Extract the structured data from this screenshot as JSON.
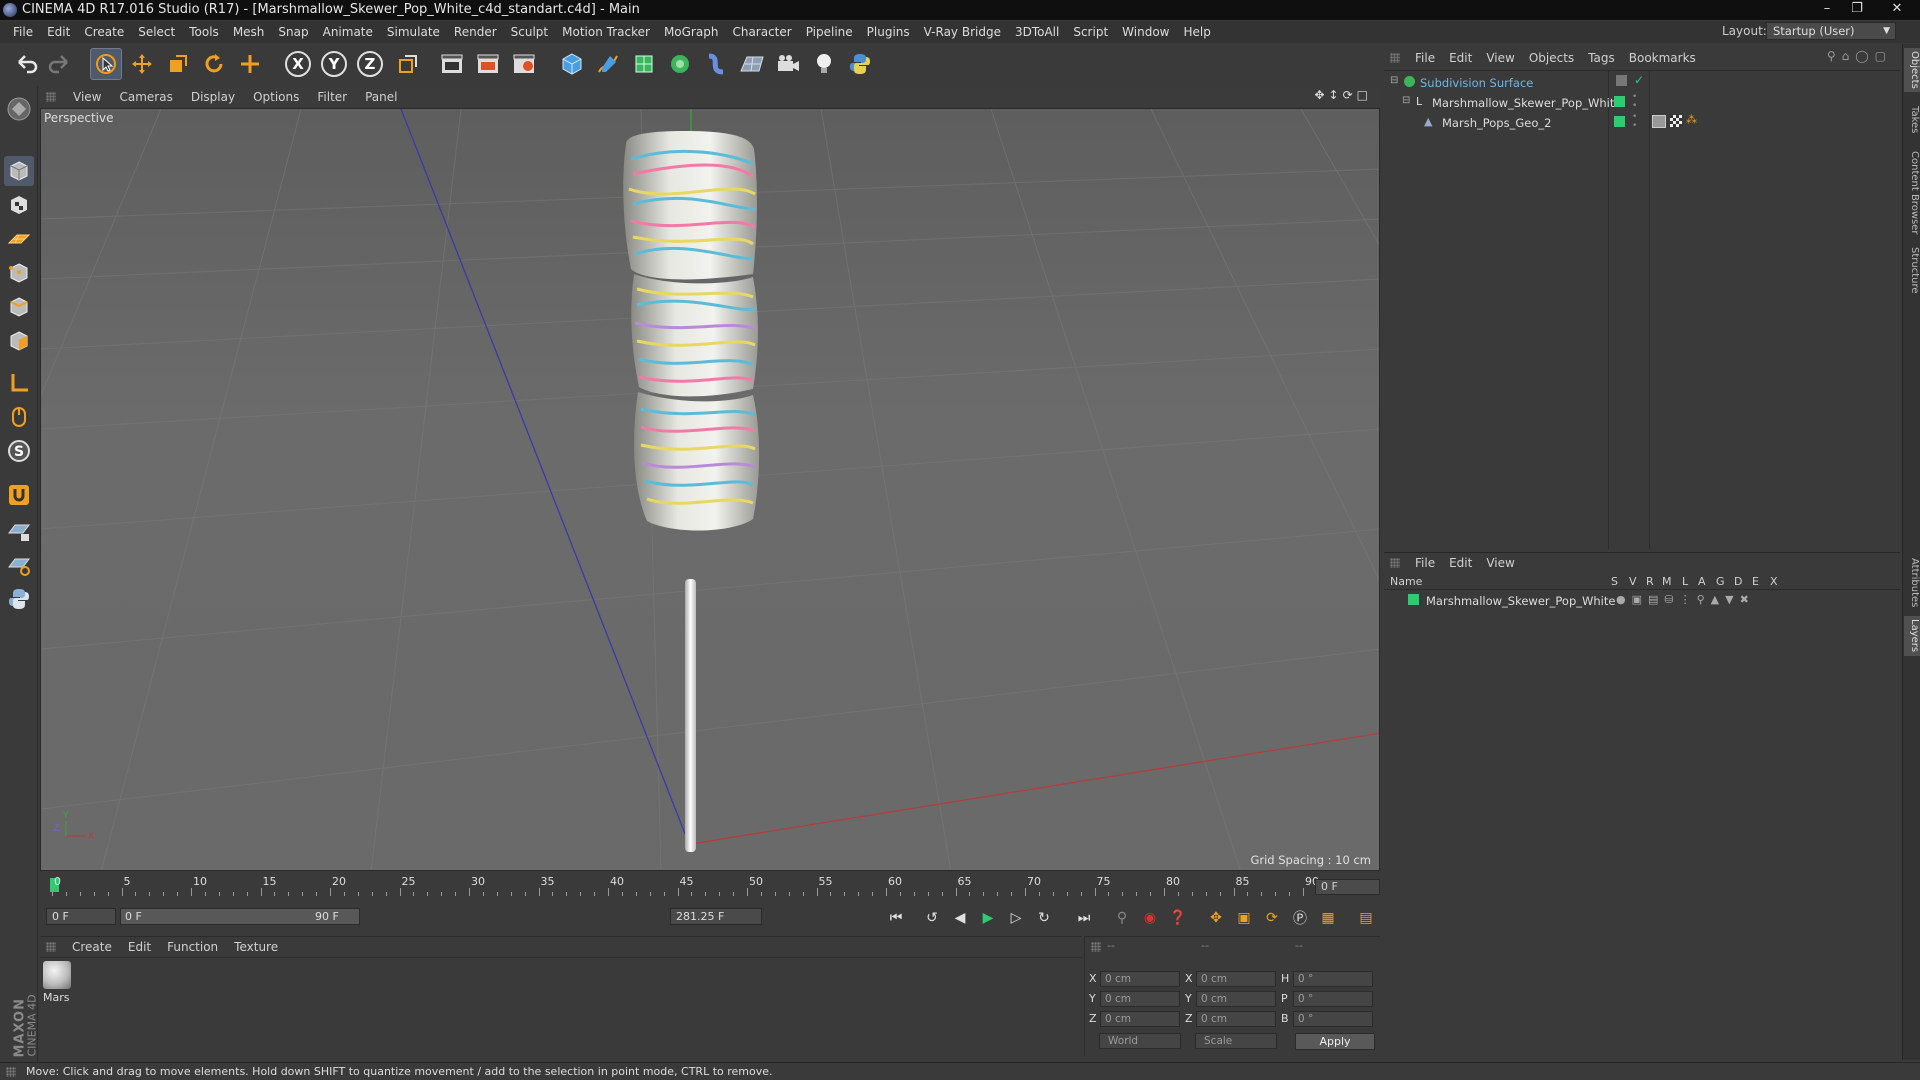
{
  "window": {
    "title": "CINEMA 4D R17.016 Studio (R17) - [Marshmallow_Skewer_Pop_White_c4d_standart.c4d] - Main"
  },
  "menubar": {
    "items": [
      "File",
      "Edit",
      "Create",
      "Select",
      "Tools",
      "Mesh",
      "Snap",
      "Animate",
      "Simulate",
      "Render",
      "Sculpt",
      "Motion Tracker",
      "MoGraph",
      "Character",
      "Pipeline",
      "Plugins",
      "V-Ray Bridge",
      "3DToAll",
      "Script",
      "Window",
      "Help"
    ],
    "layout_label": "Layout:",
    "layout_value": "Startup (User)"
  },
  "toolbar": {
    "axis_x": "X",
    "axis_y": "Y",
    "axis_z": "Z"
  },
  "viewport": {
    "menu": [
      "View",
      "Cameras",
      "Display",
      "Options",
      "Filter",
      "Panel"
    ],
    "label": "Perspective",
    "grid_spacing": "Grid Spacing : 10 cm"
  },
  "timeline": {
    "ticks": [
      "0",
      "5",
      "10",
      "15",
      "20",
      "25",
      "30",
      "35",
      "40",
      "45",
      "50",
      "55",
      "60",
      "65",
      "70",
      "75",
      "80",
      "85",
      "90"
    ],
    "current_frame_right": "0 F"
  },
  "transport": {
    "start_frame": "0 F",
    "range_start": "0 F",
    "range_end": "90 F",
    "fps_field": "281.25 F"
  },
  "material_manager": {
    "menu": [
      "Create",
      "Edit",
      "Function",
      "Texture"
    ],
    "materials": [
      {
        "name": "Mars"
      }
    ]
  },
  "coordinates": {
    "header": [
      "--",
      "--",
      "--"
    ],
    "rows": [
      {
        "a": "X",
        "a_val": "0 cm",
        "b": "X",
        "b_val": "0 cm",
        "c": "H",
        "c_val": "0 °"
      },
      {
        "a": "Y",
        "a_val": "0 cm",
        "b": "Y",
        "b_val": "0 cm",
        "c": "P",
        "c_val": "0 °"
      },
      {
        "a": "Z",
        "a_val": "0 cm",
        "b": "Z",
        "b_val": "0 cm",
        "c": "B",
        "c_val": "0 °"
      }
    ],
    "space": "World",
    "mode": "Scale",
    "apply": "Apply"
  },
  "object_manager": {
    "menu": [
      "File",
      "Edit",
      "View",
      "Objects",
      "Tags",
      "Bookmarks"
    ],
    "objects": [
      {
        "name": "Subdivision Surface",
        "color": "#6db8e8"
      },
      {
        "name": "Marshmallow_Skewer_Pop_White",
        "color": "#d0d0d0"
      },
      {
        "name": "Marsh_Pops_Geo_2",
        "color": "#d0d0d0"
      }
    ]
  },
  "layer_manager": {
    "menu": [
      "File",
      "Edit",
      "View"
    ],
    "columns": [
      "Name",
      "S",
      "V",
      "R",
      "M",
      "L",
      "A",
      "G",
      "D",
      "E",
      "X"
    ],
    "layers": [
      {
        "name": "Marshmallow_Skewer_Pop_White",
        "color": "#2ecc71"
      }
    ]
  },
  "side_tabs": [
    "Objects",
    "Takes",
    "Content Browser",
    "Structure",
    "Attributes",
    "Layers"
  ],
  "status": "Move: Click and drag to move elements. Hold down SHIFT to quantize movement / add to the selection in point mode, CTRL to remove.",
  "brand": {
    "line1": "MAXON",
    "line2": "CINEMA 4D"
  },
  "colors": {
    "accent": "#2ecc71",
    "panel": "#3a3a3a",
    "viewport": "#666666"
  }
}
